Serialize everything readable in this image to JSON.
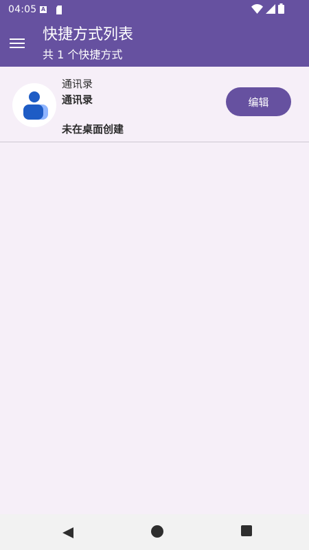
{
  "status_bar": {
    "time": "04:05",
    "a_icon_label": "A",
    "icons": [
      "wifi-icon",
      "signal-icon",
      "battery-icon"
    ]
  },
  "header": {
    "title": "快捷方式列表",
    "subtitle": "共 1 个快捷方式",
    "background_color": "#6651a0"
  },
  "shortcuts": [
    {
      "app_label": "通讯录",
      "name": "通讯录",
      "status": "未在桌面创建",
      "edit_label": "编辑",
      "icon": "contacts-icon"
    }
  ],
  "navigation": {
    "buttons": [
      "back-icon",
      "home-icon",
      "recents-icon"
    ]
  },
  "colors": {
    "accent": "#6651a0",
    "background": "#f6eff8"
  }
}
